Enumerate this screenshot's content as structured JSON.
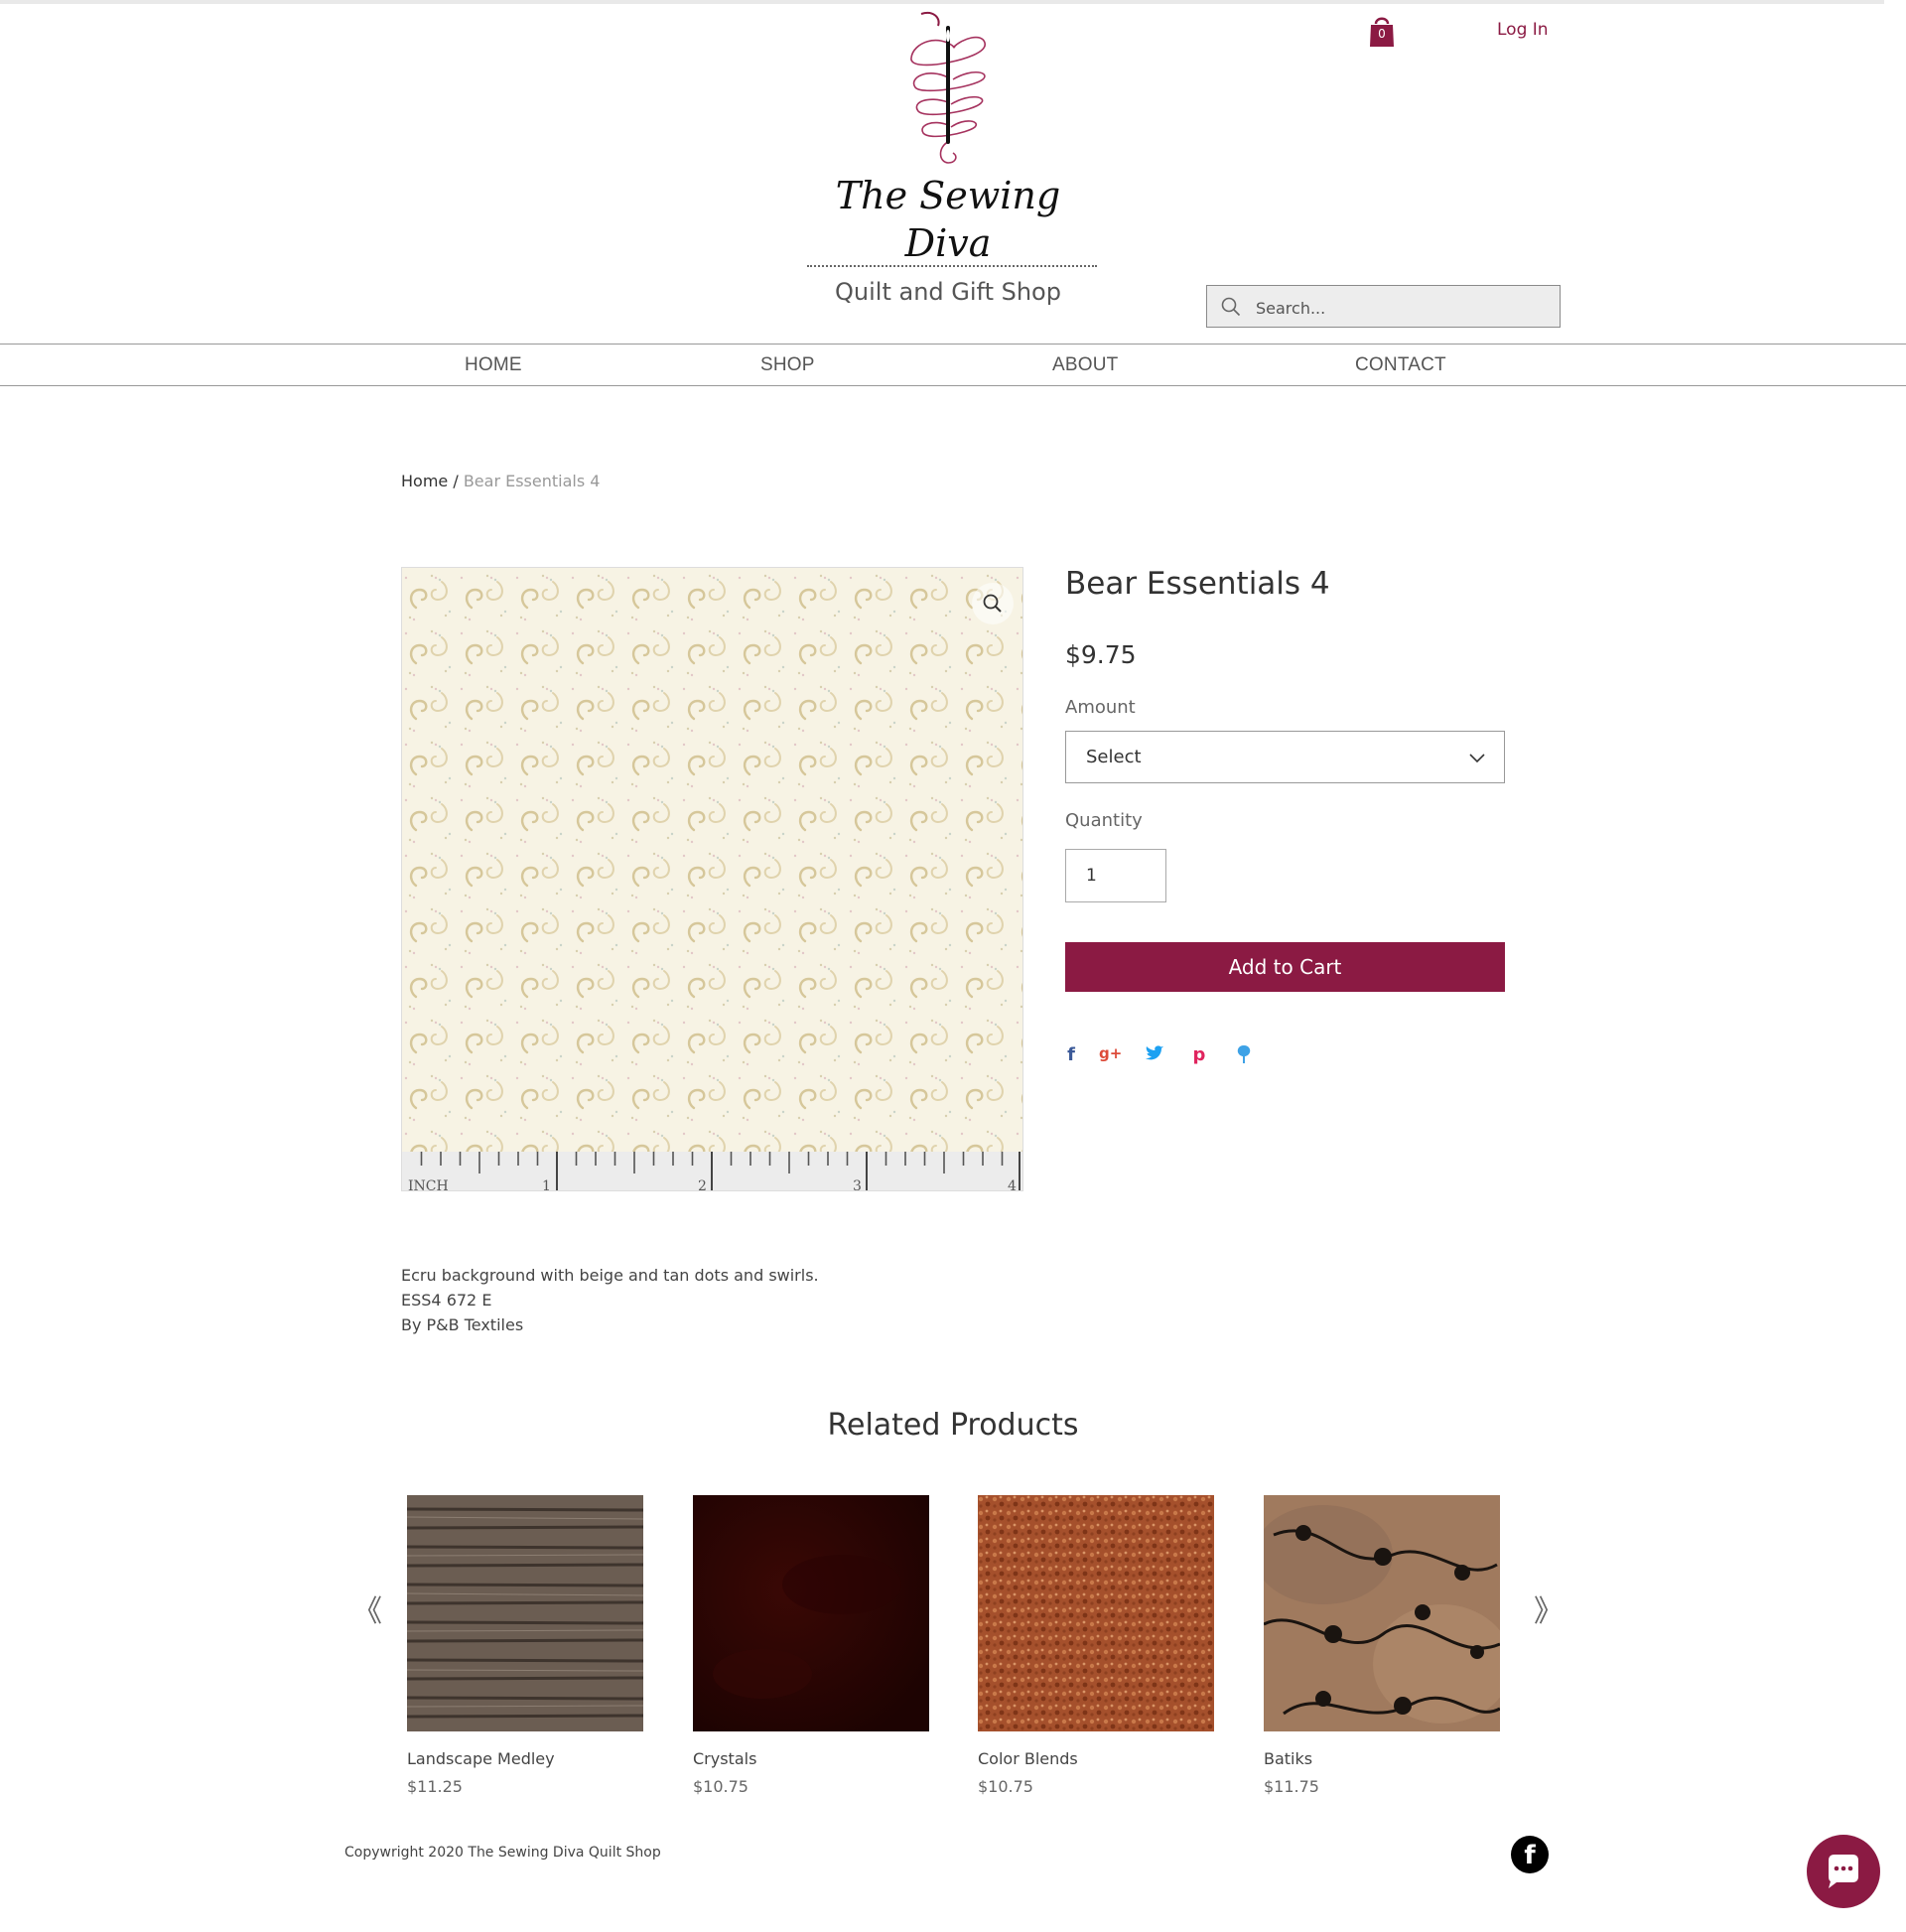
{
  "brand": {
    "name_line1": "The Sewing",
    "name_line2": "Diva",
    "tagline": "Quilt and Gift Shop",
    "accent_color": "#8b1a43"
  },
  "header": {
    "cart_count": "0",
    "login_label": "Log In",
    "search_placeholder": "Search..."
  },
  "nav": {
    "items": [
      {
        "label": "HOME"
      },
      {
        "label": "SHOP"
      },
      {
        "label": "ABOUT"
      },
      {
        "label": "CONTACT"
      }
    ]
  },
  "breadcrumb": {
    "home": "Home",
    "separator": " / ",
    "current": "Bear Essentials 4"
  },
  "product": {
    "title": "Bear Essentials 4",
    "price": "$9.75",
    "amount_label": "Amount",
    "amount_selected": "Select",
    "quantity_label": "Quantity",
    "quantity_value": "1",
    "add_to_cart_label": "Add to Cart",
    "ruler_labels": [
      "INCH",
      "1",
      "2",
      "3",
      "4"
    ],
    "share_icons": [
      "facebook-icon",
      "google-plus-icon",
      "twitter-icon",
      "pinterest-icon",
      "fancy-icon"
    ],
    "description": [
      "Ecru background with beige and tan dots and swirls.",
      "ESS4 672 E",
      "By P&B Textiles"
    ]
  },
  "related": {
    "title": "Related Products",
    "items": [
      {
        "name": "Landscape Medley",
        "price": "$11.25"
      },
      {
        "name": "Crystals",
        "price": "$10.75"
      },
      {
        "name": "Color Blends",
        "price": "$10.75"
      },
      {
        "name": "Batiks",
        "price": "$11.75"
      }
    ],
    "prev_glyph": "《",
    "next_glyph": "》"
  },
  "footer": {
    "copyright": "Copywright 2020 The Sewing Diva Quilt Shop",
    "social_icon": "facebook-icon",
    "chat_icon": "chat-bubble-icon"
  }
}
